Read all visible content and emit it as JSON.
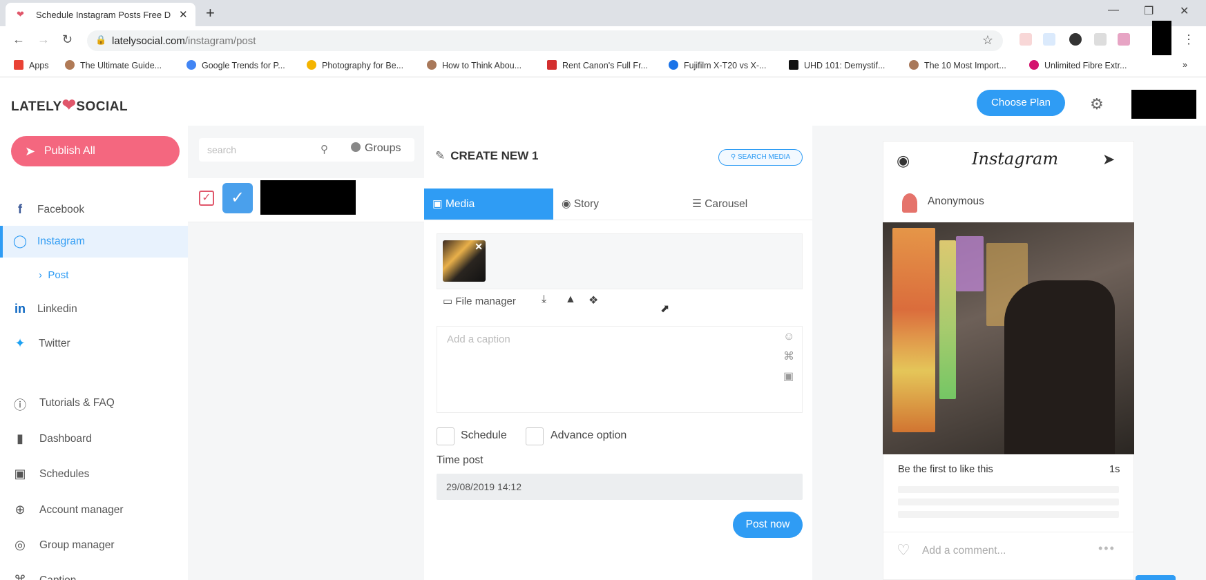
{
  "browser": {
    "tab_title": "Schedule Instagram Posts Free D",
    "url_host": "latelysocial.com",
    "url_path": "/instagram/post",
    "bookmarks": [
      {
        "label": "Apps",
        "color": "#e94235"
      },
      {
        "label": "The Ultimate Guide...",
        "color": "#b07a56"
      },
      {
        "label": "Google Trends for P...",
        "color": "#4285f4"
      },
      {
        "label": "Photography for Be...",
        "color": "#f4b400"
      },
      {
        "label": "How to Think Abou...",
        "color": "#a8785a"
      },
      {
        "label": "Rent Canon's Full Fr...",
        "color": "#d32f2f"
      },
      {
        "label": "Fujifilm X-T20 vs X-...",
        "color": "#1a73e8"
      },
      {
        "label": "UHD 101: Demystif...",
        "color": "#111111"
      },
      {
        "label": "The 10 Most Import...",
        "color": "#a8785a"
      },
      {
        "label": "Unlimited Fibre Extr...",
        "color": "#d4146e"
      }
    ]
  },
  "app": {
    "brand_left": "LATELY",
    "brand_right": "SOCIAL",
    "choose_plan": "Choose Plan",
    "accent": "#2f9cf4",
    "brand_pink": "#f4677f"
  },
  "sidebar": {
    "publish_all": "Publish All",
    "networks": [
      {
        "label": "Facebook",
        "icon": "facebook-icon"
      },
      {
        "label": "Instagram",
        "icon": "instagram-icon"
      },
      {
        "label": "Linkedin",
        "icon": "linkedin-icon"
      },
      {
        "label": "Twitter",
        "icon": "twitter-icon"
      }
    ],
    "sub_post": "Post",
    "tools": [
      {
        "label": "Tutorials & FAQ",
        "icon": "help-icon"
      },
      {
        "label": "Dashboard",
        "icon": "bar-chart-icon"
      },
      {
        "label": "Schedules",
        "icon": "calendar-icon"
      },
      {
        "label": "Account manager",
        "icon": "plus-circle-icon"
      },
      {
        "label": "Group manager",
        "icon": "target-icon"
      },
      {
        "label": "Caption",
        "icon": "command-icon"
      }
    ]
  },
  "accounts": {
    "search_placeholder": "search",
    "groups_label": "Groups"
  },
  "editor": {
    "title": "CREATE NEW 1",
    "search_media": "SEARCH MEDIA",
    "tabs": [
      "Media",
      "Story",
      "Carousel"
    ],
    "file_manager": "File manager",
    "caption_placeholder": "Add a caption",
    "schedule_label": "Schedule",
    "advance_label": "Advance option",
    "time_post_label": "Time post",
    "time_post_value": "29/08/2019 14:12",
    "post_now": "Post now"
  },
  "preview": {
    "logo": "Instagram",
    "username": "Anonymous",
    "likes_text": "Be the first to like this",
    "time_ago": "1s",
    "add_comment": "Add a comment..."
  }
}
